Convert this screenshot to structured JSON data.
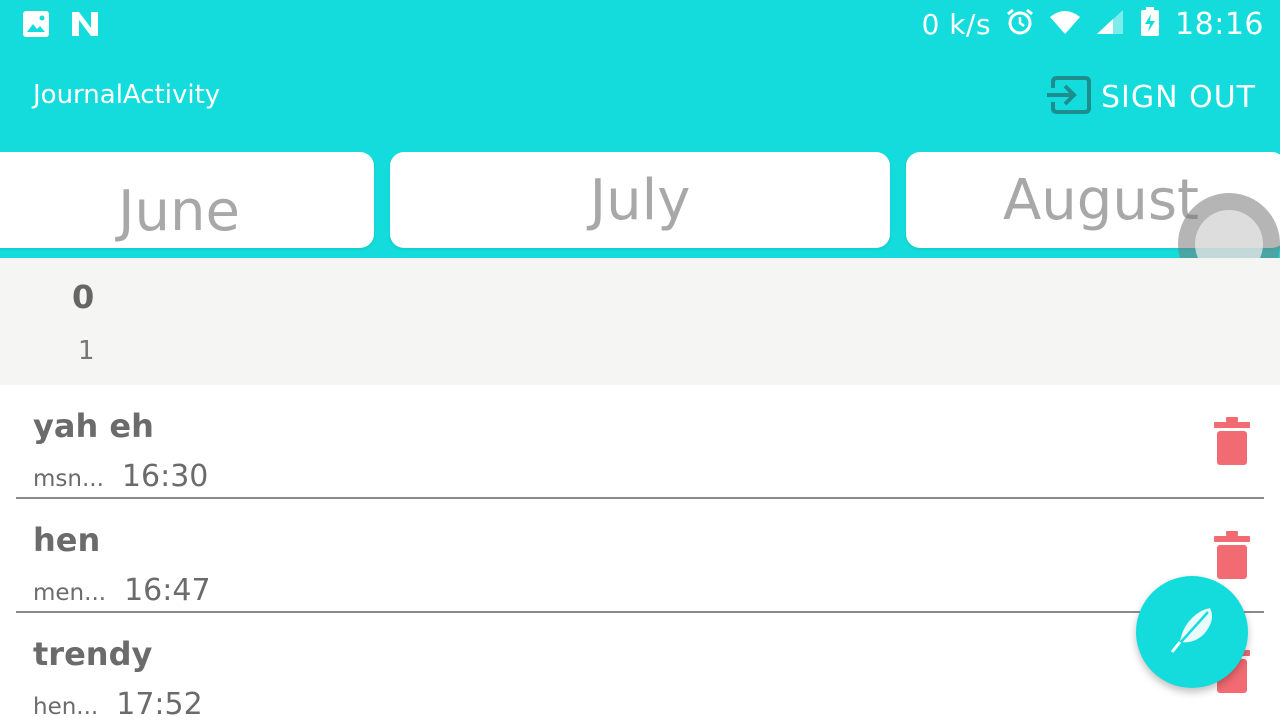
{
  "status_bar": {
    "speed": "0 k/s",
    "time": "18:16"
  },
  "app_bar": {
    "title": "JournalActivity",
    "sign_out_label": "SIGN OUT"
  },
  "months": [
    "June",
    "July",
    "August"
  ],
  "summary": {
    "count": "0",
    "sub": "1"
  },
  "entries": [
    {
      "title": "yah eh",
      "preview": "msn...",
      "time": "16:30"
    },
    {
      "title": "hen",
      "preview": "men...",
      "time": "16:47"
    },
    {
      "title": "trendy",
      "preview": "hen...",
      "time": "17:52"
    }
  ],
  "colors": {
    "primary": "#14dcdc",
    "delete": "#f26b73",
    "text": "#6b6b6b"
  },
  "icons": {
    "status_left": [
      "image-icon",
      "n-icon"
    ],
    "status_right": [
      "alarm-icon",
      "wifi-icon",
      "signal-icon",
      "battery-charging-icon"
    ],
    "sign_out": "exit-icon",
    "delete": "trash-icon",
    "fab": "feather-icon"
  }
}
